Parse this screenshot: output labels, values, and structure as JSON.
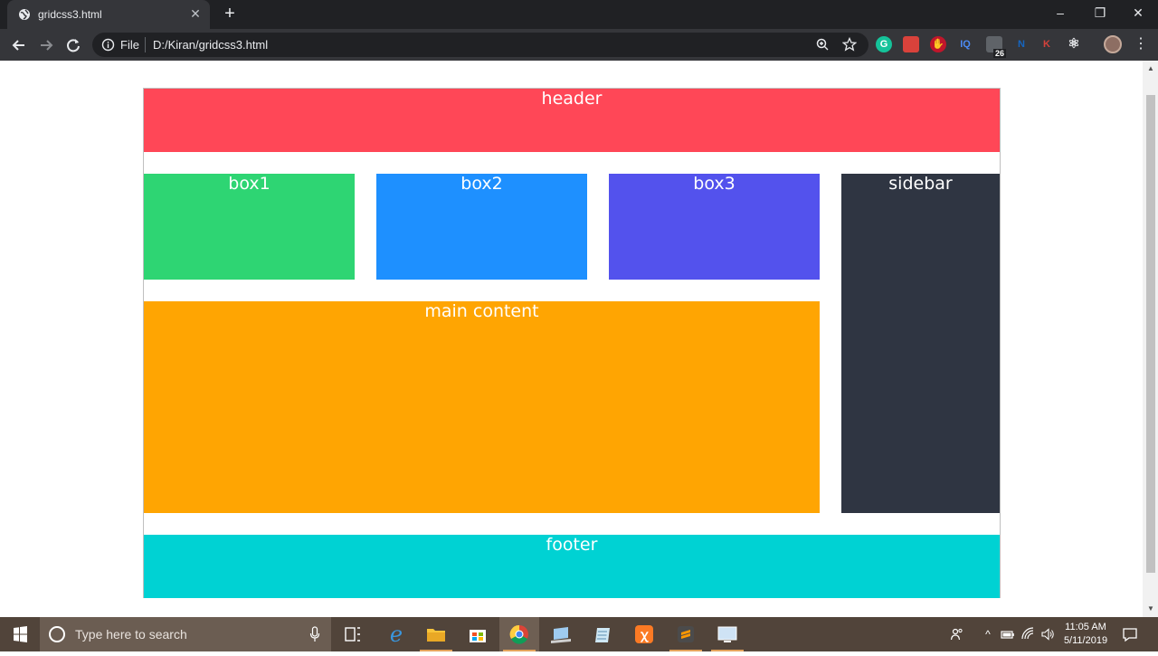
{
  "browser": {
    "tab_title": "gridcss3.html",
    "scheme_label": "File",
    "url": "D:/Kiran/gridcss3.html",
    "extension_badge": "26",
    "extensions": [
      {
        "name": "grammarly",
        "glyph": "G",
        "color": "#15c39a"
      },
      {
        "name": "bookmark-red",
        "glyph": "",
        "color": "#d9423b"
      },
      {
        "name": "ublock",
        "glyph": "",
        "color": "#c0162b"
      },
      {
        "name": "iq",
        "glyph": "IQ",
        "color": "#4c8bf5"
      },
      {
        "name": "screen-ext",
        "glyph": "",
        "color": "#5f6368"
      },
      {
        "name": "n-ext",
        "glyph": "N",
        "color": "#1565c0"
      },
      {
        "name": "k-ext",
        "glyph": "K",
        "color": "#d5423b"
      },
      {
        "name": "react-devtools",
        "glyph": "⚛",
        "color": "#e8eaed"
      }
    ]
  },
  "layout_demo": {
    "header": {
      "label": "header",
      "color": "#ff4757"
    },
    "box1": {
      "label": "box1",
      "color": "#2ed573"
    },
    "box2": {
      "label": "box2",
      "color": "#1e90ff"
    },
    "box3": {
      "label": "box3",
      "color": "#5352ed"
    },
    "sidebar": {
      "label": "sidebar",
      "color": "#2f3542"
    },
    "main": {
      "label": "main content",
      "color": "#ffa502"
    },
    "footer": {
      "label": "footer",
      "color": "#00d2d3"
    }
  },
  "taskbar": {
    "search_placeholder": "Type here to search",
    "time": "11:05 AM",
    "date": "5/11/2019"
  }
}
